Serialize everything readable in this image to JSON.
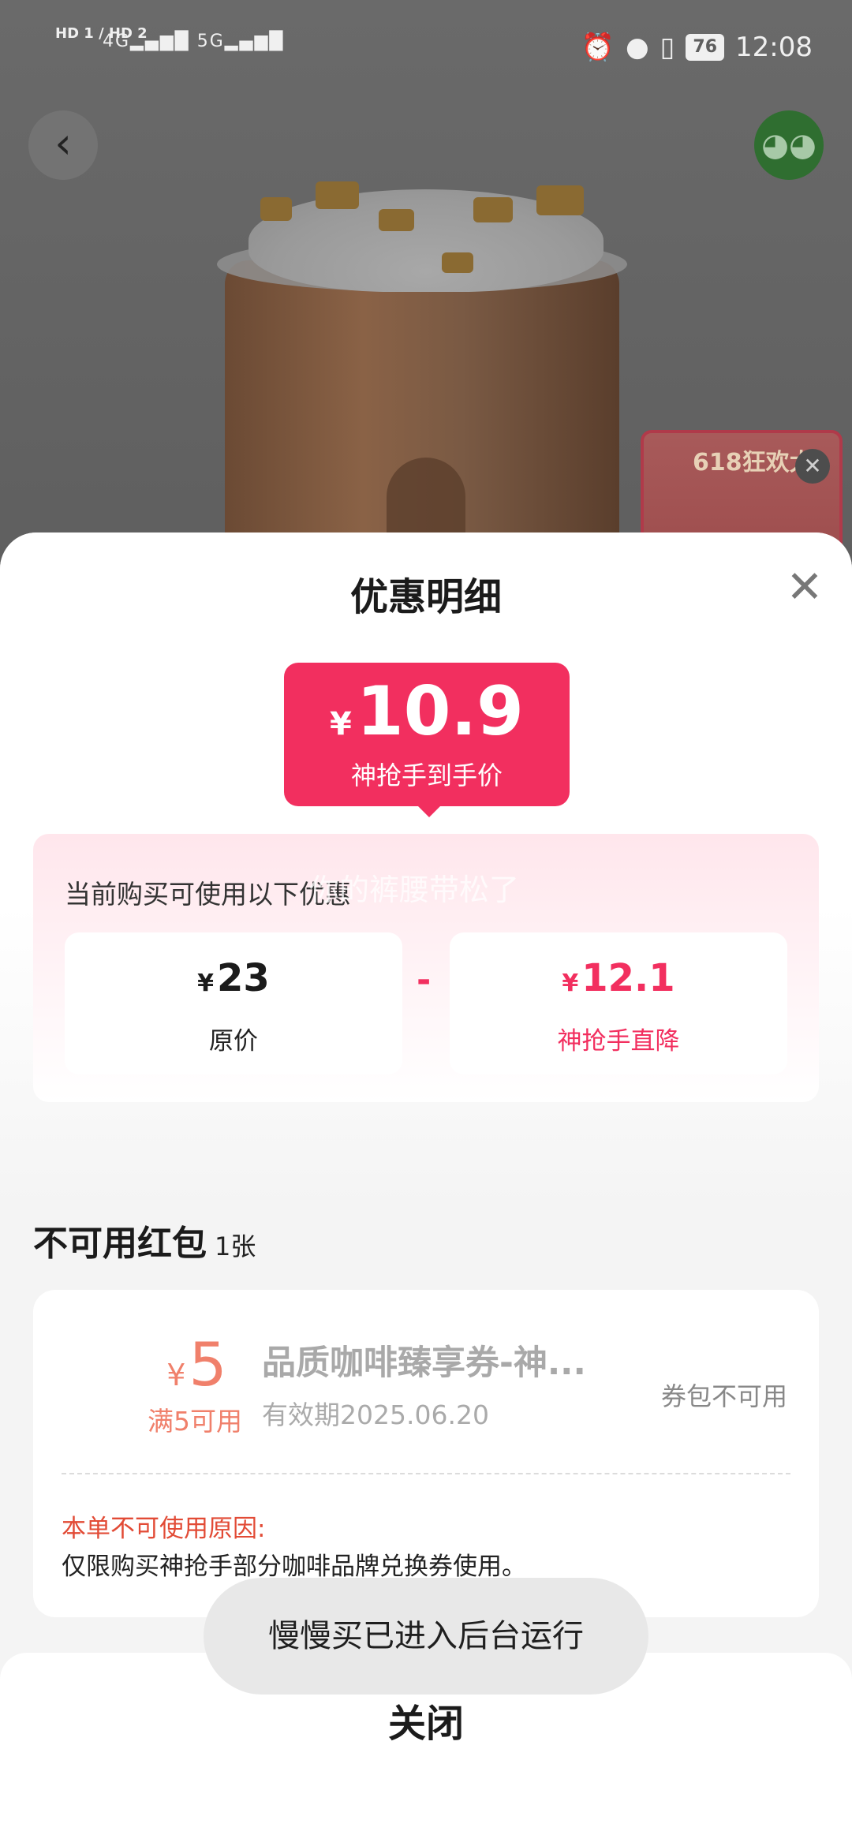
{
  "status_bar": {
    "sim_labels": "HD 1 / HD 2",
    "network_1": "4G",
    "network_2": "5G",
    "battery": "76",
    "time": "12:08"
  },
  "background": {
    "promo_text": "618狂欢大"
  },
  "icons": {
    "back": "chevron-left-icon",
    "share": "wechat-icon",
    "close": "close-icon"
  },
  "sheet": {
    "title": "优惠明细",
    "final_price": {
      "currency": "¥",
      "amount": "10.9",
      "label": "神抢手到手价"
    },
    "discount_label": "当前购买可使用以下优惠",
    "watermark": "你的裤腰带松了",
    "original": {
      "currency": "¥",
      "amount": "23",
      "label": "原价"
    },
    "minus": "-",
    "reduction": {
      "currency": "¥",
      "amount": "12.1",
      "label": "神抢手直降"
    },
    "unavailable_title": "不可用红包",
    "unavailable_count": "1张",
    "coupon": {
      "currency": "¥",
      "amount": "5",
      "condition": "满5可用",
      "name": "品质咖啡臻享券-神...",
      "expiry": "有效期2025.06.20",
      "status": "券包不可用",
      "reason_title": "本单不可使用原因:",
      "reason_text": "仅限购买神抢手部分咖啡品牌兑换券使用。"
    },
    "footer_button": "关闭"
  },
  "toast": "慢慢买已进入后台运行",
  "colors": {
    "accent": "#f22f5f",
    "coupon": "#f0806b",
    "reason": "#e24b36"
  }
}
